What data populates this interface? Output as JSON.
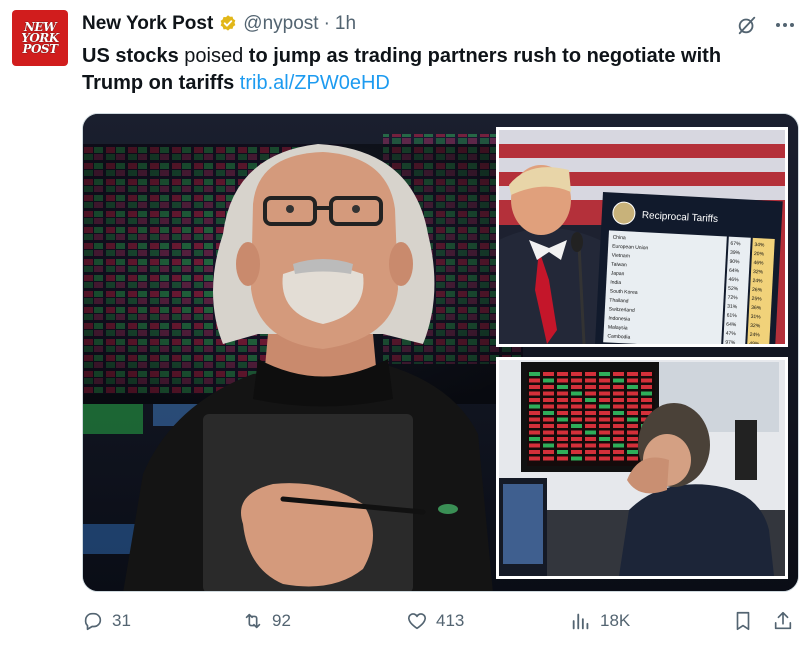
{
  "account": {
    "avatar_lines": [
      "NEW",
      "YORK",
      "POST"
    ],
    "name": "New York Post",
    "handle": "@nypost",
    "separator": "·",
    "time": "1h"
  },
  "tweet": {
    "part1_bold": "US stocks",
    "part2": " poised ",
    "part3_bold": "to jump as trading partners rush to negotiate with Trump on tariffs",
    "link": "trib.al/ZPW0eHD"
  },
  "media": {
    "inset1_board_title": "Reciprocal Tariffs",
    "inset1_countries": [
      "China",
      "European Union",
      "Vietnam",
      "Taiwan",
      "Japan",
      "India",
      "South Korea",
      "Thailand",
      "Switzerland",
      "Indonesia",
      "Malaysia",
      "Cambodia"
    ],
    "inset1_charged": [
      "67%",
      "39%",
      "90%",
      "64%",
      "46%",
      "52%",
      "72%",
      "31%",
      "61%",
      "64%",
      "47%",
      "97%"
    ],
    "inset1_reciprocal": [
      "34%",
      "20%",
      "46%",
      "32%",
      "24%",
      "26%",
      "25%",
      "36%",
      "31%",
      "32%",
      "24%",
      "49%"
    ]
  },
  "actions": {
    "replies": "31",
    "reposts": "92",
    "likes": "413",
    "views": "18K"
  },
  "colors": {
    "brand_red": "#d11d1d",
    "link_blue": "#1d9bf0",
    "verified_gold": "#e2b719",
    "muted": "#536471"
  }
}
